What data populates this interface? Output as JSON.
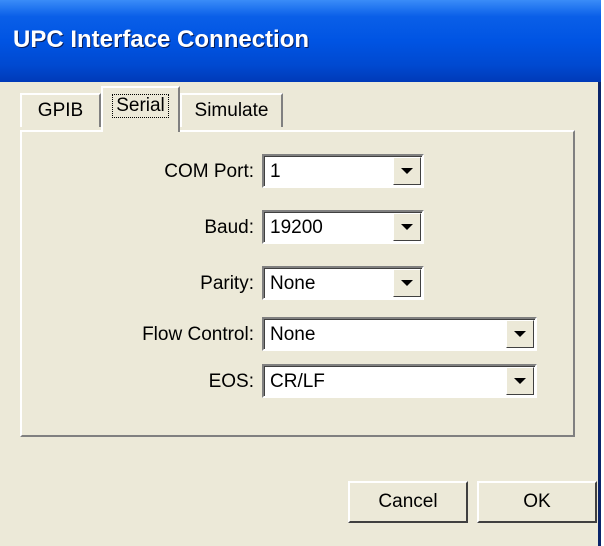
{
  "window": {
    "title": "UPC Interface Connection"
  },
  "tabs": [
    {
      "label": "GPIB"
    },
    {
      "label": "Serial",
      "selected": true
    },
    {
      "label": "Simulate"
    }
  ],
  "fields": {
    "com_port": {
      "label": "COM Port:",
      "value": "1"
    },
    "baud": {
      "label": "Baud:",
      "value": "19200"
    },
    "parity": {
      "label": "Parity:",
      "value": "None"
    },
    "flow_control": {
      "label": "Flow Control:",
      "value": "None"
    },
    "eos": {
      "label": "EOS:",
      "value": "CR/LF"
    }
  },
  "buttons": {
    "cancel": "Cancel",
    "ok": "OK"
  },
  "icons": {
    "dropdown": "chevron-down-icon"
  },
  "colors": {
    "titlebar": "#0054e3",
    "face": "#ece9d8"
  }
}
